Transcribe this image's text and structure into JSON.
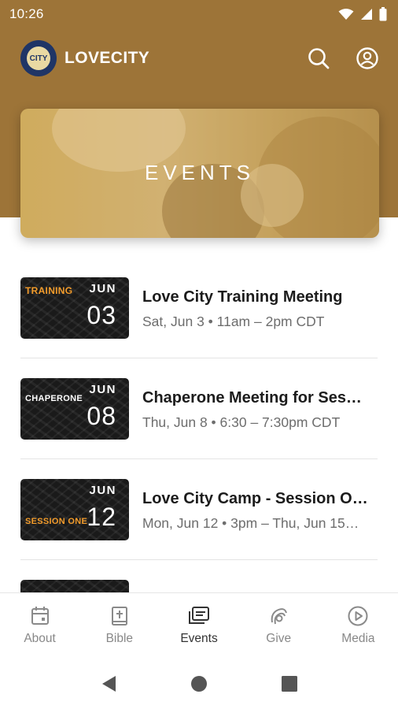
{
  "status_bar": {
    "time": "10:26"
  },
  "app_bar": {
    "title": "LOVECITY",
    "logo_text": "CITY"
  },
  "hero": {
    "title": "EVENTS"
  },
  "events": [
    {
      "thumb_label": "TRAINING",
      "thumb_month": "JUN",
      "thumb_day": "03",
      "title": "Love City Training Meeting",
      "meta": "Sat, Jun 3 • 11am – 2pm CDT"
    },
    {
      "thumb_label": "CHAPERONE",
      "thumb_month": "JUN",
      "thumb_day": "08",
      "title": "Chaperone Meeting for Ses…",
      "meta": "Thu, Jun 8 • 6:30 – 7:30pm CDT"
    },
    {
      "thumb_label": "SESSION ONE",
      "thumb_month": "JUN",
      "thumb_day": "12",
      "title": "Love City Camp - Session O…",
      "meta": "Mon, Jun 12 • 3pm – Thu, Jun 15…"
    }
  ],
  "bottom_nav": [
    {
      "label": "About",
      "icon": "calendar-icon"
    },
    {
      "label": "Bible",
      "icon": "bible-icon"
    },
    {
      "label": "Events",
      "icon": "events-icon"
    },
    {
      "label": "Give",
      "icon": "give-icon"
    },
    {
      "label": "Media",
      "icon": "play-icon"
    }
  ],
  "colors": {
    "header": "#9d7438",
    "accent": "#f39c2b",
    "text": "#1c1c1c",
    "muted": "#6d6d6d"
  }
}
